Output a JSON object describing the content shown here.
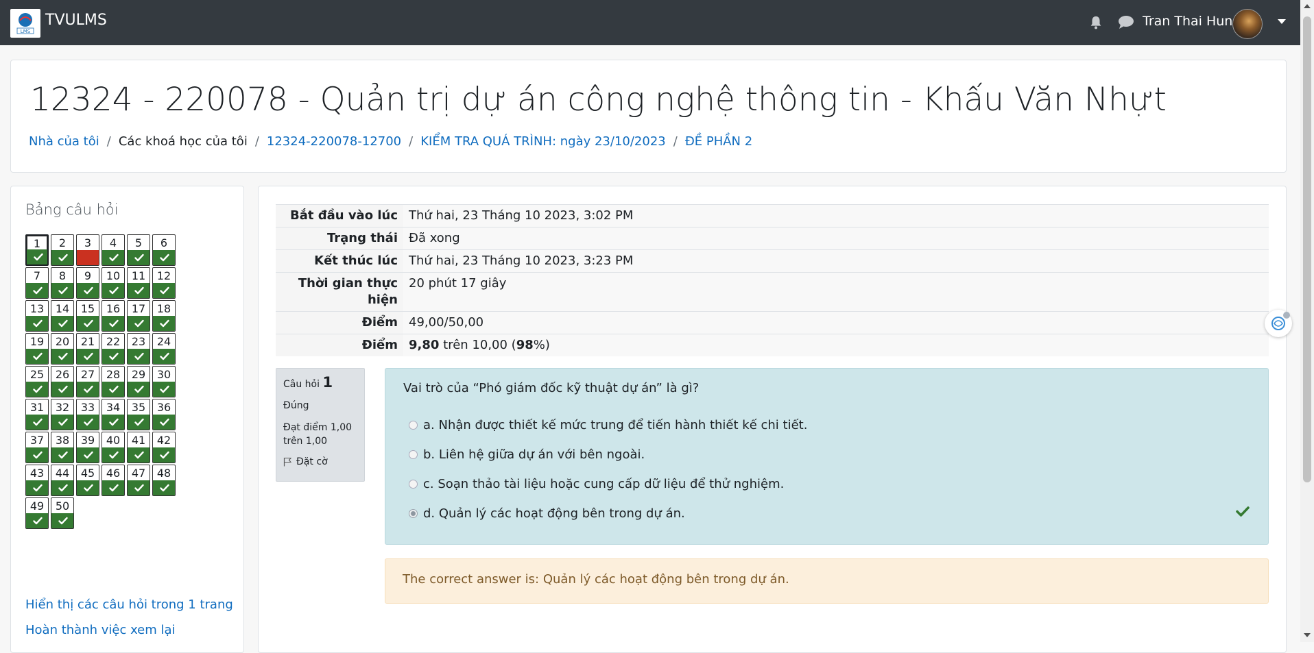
{
  "navbar": {
    "brand": "TVULMS",
    "logo_text": "LMS",
    "user_name": "Tran Thai Hung"
  },
  "header": {
    "title": "12324 - 220078 - Quản trị dự án công nghệ thông tin - Khấu Văn Nhựt",
    "breadcrumb": [
      "Nhà của tôi",
      "Các khoá học của tôi",
      "12324-220078-12700",
      "KIỂM TRA QUÁ TRÌNH: ngày 23/10/2023",
      "ĐỀ PHẦN 2"
    ]
  },
  "sidebar": {
    "title": "Bảng câu hỏi",
    "questions": [
      "1",
      "2",
      "3",
      "4",
      "5",
      "6",
      "7",
      "8",
      "9",
      "10",
      "11",
      "12",
      "13",
      "14",
      "15",
      "16",
      "17",
      "18",
      "19",
      "20",
      "21",
      "22",
      "23",
      "24",
      "25",
      "26",
      "27",
      "28",
      "29",
      "30",
      "31",
      "32",
      "33",
      "34",
      "35",
      "36",
      "37",
      "38",
      "39",
      "40",
      "41",
      "42",
      "43",
      "44",
      "45",
      "46",
      "47",
      "48",
      "49",
      "50"
    ],
    "wrong_question": "3",
    "current_question": "1",
    "links": [
      "Hiển thị các câu hỏi trong 1 trang",
      "Hoàn thành việc xem lại"
    ]
  },
  "summary": {
    "rows": [
      {
        "label": "Bắt đầu vào lúc",
        "value": "Thứ hai, 23 Tháng 10 2023, 3:02 PM"
      },
      {
        "label": "Trạng thái",
        "value": "Đã xong"
      },
      {
        "label": "Kết thúc lúc",
        "value": "Thứ hai, 23 Tháng 10 2023, 3:23 PM"
      },
      {
        "label": "Thời gian thực hiện",
        "value": "20 phút 17 giây"
      },
      {
        "label": "Điểm",
        "value": "49,00/50,00"
      }
    ],
    "grade_label": "Điểm",
    "grade_score": "9,80",
    "grade_mid": " trên 10,00 (",
    "grade_percent": "98",
    "grade_end": "%)"
  },
  "question": {
    "prefix": "Câu hỏi",
    "number": "1",
    "state": "Đúng",
    "mark": "Đạt điểm 1,00 trên 1,00",
    "flag_label": "Đặt cờ",
    "text": "Vai trò của “Phó giám đốc kỹ thuật dự án” là gì?",
    "options": [
      "a. Nhận được thiết kế mức trung để tiến hành thiết kế chi tiết.",
      "b. Liên hệ giữa dự án với bên ngoài.",
      "c. Soạn thảo tài liệu hoặc cung cấp dữ liệu để thử nghiệm.",
      "d. Quản lý các hoạt động bên trong dự án."
    ],
    "selected_option": "d",
    "feedback": "The correct answer is: Quản lý các hoạt động bên trong dự án."
  },
  "colors": {
    "navbar": "#343a40",
    "link": "#0f6cbf",
    "correct": "#357a32",
    "incorrect": "#ca3120",
    "question_bg": "#cee6ea",
    "feedback_bg": "#fcefdc"
  }
}
